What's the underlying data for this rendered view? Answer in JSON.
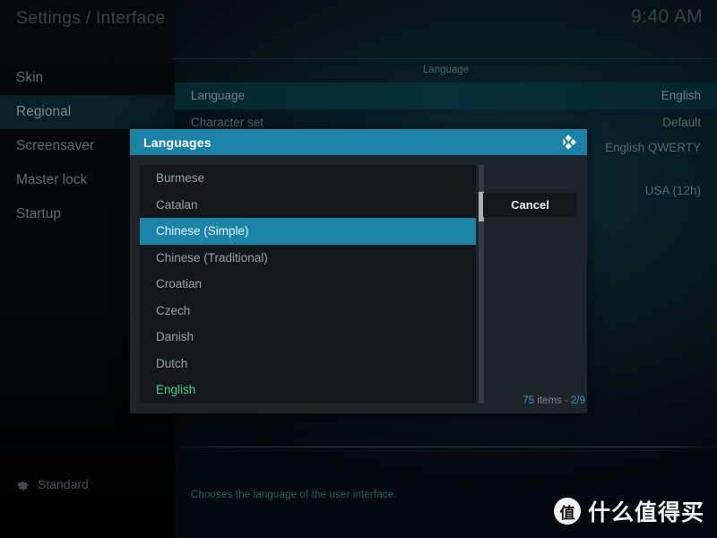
{
  "window": {
    "app_title": "Settings / Interface",
    "clock": "9:40 AM"
  },
  "sidebar": {
    "items": [
      {
        "label": "Skin",
        "active": false
      },
      {
        "label": "Regional",
        "active": true
      },
      {
        "label": "Screensaver",
        "active": false
      },
      {
        "label": "Master lock",
        "active": false
      },
      {
        "label": "Startup",
        "active": false
      }
    ],
    "level": {
      "icon": "gear-icon",
      "label": "Standard"
    }
  },
  "settings": {
    "section_header": "Language",
    "rows": [
      {
        "label": "Language",
        "value": "English",
        "selected": true
      },
      {
        "label": "Character set",
        "value": "Default",
        "selected": false
      },
      {
        "label": "",
        "value": "English QWERTY",
        "selected": false
      },
      {
        "label": "",
        "value": "USA (12h)",
        "selected": false
      }
    ],
    "description": "Chooses the language of the user interface."
  },
  "dialog": {
    "title": "Languages",
    "logo_icon": "kodi-logo-icon",
    "items": [
      {
        "label": "Burmese",
        "state": "normal"
      },
      {
        "label": "Catalan",
        "state": "normal"
      },
      {
        "label": "Chinese (Simple)",
        "state": "selected"
      },
      {
        "label": "Chinese (Traditional)",
        "state": "normal"
      },
      {
        "label": "Croatian",
        "state": "normal"
      },
      {
        "label": "Czech",
        "state": "normal"
      },
      {
        "label": "Danish",
        "state": "normal"
      },
      {
        "label": "Dutch",
        "state": "normal"
      },
      {
        "label": "English",
        "state": "current"
      }
    ],
    "cancel_label": "Cancel",
    "count": {
      "items": "75",
      "items_word": "items -",
      "page": "2/9"
    }
  },
  "watermark": {
    "badge": "值",
    "text": "什么值得买"
  },
  "colors": {
    "accent": "#1a84a6",
    "selected_row": "#083038",
    "current_item": "#3ccf92",
    "count_highlight": "#2f97bd"
  }
}
